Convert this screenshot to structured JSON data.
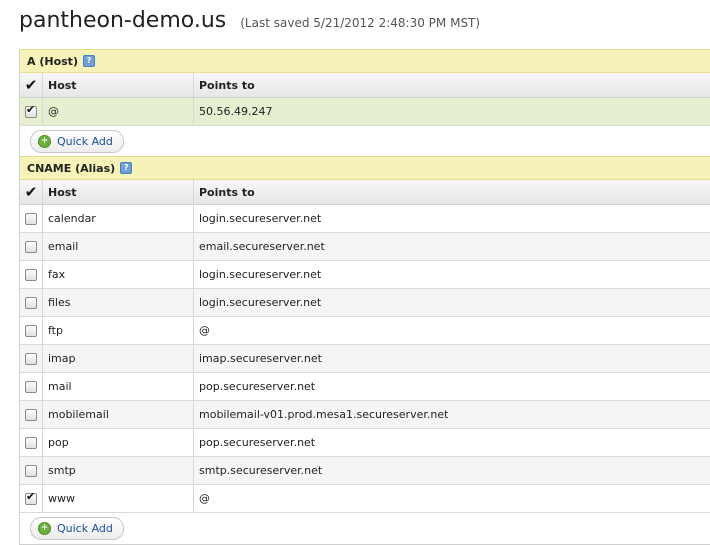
{
  "page": {
    "domain_name": "pantheon-demo.us",
    "last_saved": "(Last saved 5/21/2012 2:48:30 PM MST)"
  },
  "icons": {
    "help": "help-icon",
    "select_all": "checkmark-icon",
    "add": "plus-icon"
  },
  "columns": {
    "host": "Host",
    "points_to": "Points to"
  },
  "a_records": {
    "title": "A (Host)",
    "quick_add_label": "Quick Add",
    "rows": [
      {
        "host": "@",
        "points_to": "50.56.49.247",
        "checked": true
      }
    ]
  },
  "cname_records": {
    "title": "CNAME (Alias)",
    "quick_add_label": "Quick Add",
    "rows": [
      {
        "host": "calendar",
        "points_to": "login.secureserver.net",
        "checked": false
      },
      {
        "host": "email",
        "points_to": "email.secureserver.net",
        "checked": false
      },
      {
        "host": "fax",
        "points_to": "login.secureserver.net",
        "checked": false
      },
      {
        "host": "files",
        "points_to": "login.secureserver.net",
        "checked": false
      },
      {
        "host": "ftp",
        "points_to": "@",
        "checked": false
      },
      {
        "host": "imap",
        "points_to": "imap.secureserver.net",
        "checked": false
      },
      {
        "host": "mail",
        "points_to": "pop.secureserver.net",
        "checked": false
      },
      {
        "host": "mobilemail",
        "points_to": "mobilemail-v01.prod.mesa1.secureserver.net",
        "checked": false
      },
      {
        "host": "pop",
        "points_to": "pop.secureserver.net",
        "checked": false
      },
      {
        "host": "smtp",
        "points_to": "smtp.secureserver.net",
        "checked": false
      },
      {
        "host": "www",
        "points_to": "@",
        "checked": true
      }
    ]
  }
}
